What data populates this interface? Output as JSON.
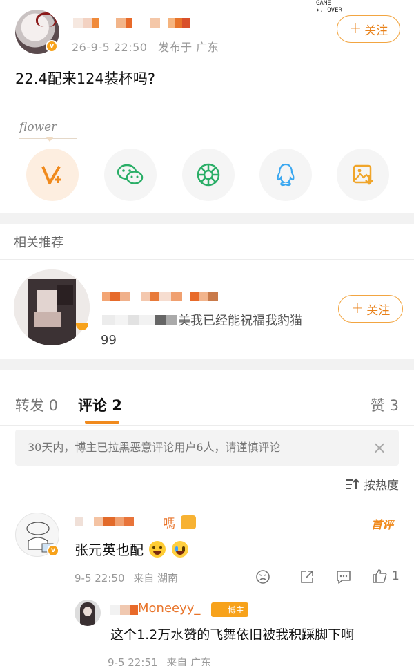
{
  "post": {
    "timestamp": "26-9-5 22:50",
    "location": "发布于 广东",
    "follow_label": "关注",
    "plus": "+",
    "text": "22.4配来124装杯吗?",
    "flower_label": "flower",
    "sticker_line1": "GAME",
    "sticker_line2": "✦. OVER"
  },
  "share": {
    "items": [
      "v-plus-icon",
      "wechat-icon",
      "moments-icon",
      "qq-icon",
      "save-image-icon"
    ]
  },
  "related": {
    "title": "相关推荐",
    "name_partial": "Moneeyy",
    "desc_partial": "美我已经能祝福我豹猫",
    "count": "99",
    "follow_label": "关注",
    "plus": "+"
  },
  "tabs": {
    "repost": "转发 0",
    "comments": "评论 2",
    "likes": "赞 3"
  },
  "notice": {
    "text": "30天内，博主已拉黑恶意评论用户6人，请谨慎评论",
    "close": "×"
  },
  "sort": {
    "label": "按热度"
  },
  "comments": [
    {
      "name_partial": "嗎",
      "badge": "首评",
      "text": "张元英也配",
      "timestamp": "9-5 22:50",
      "location": "来自 湖南",
      "likes": "1"
    },
    {
      "name_partial": "Moneeyy_",
      "author_badge": "博主",
      "text": "这个1.2万水赞的飞舞依旧被我积踩脚下啊",
      "timestamp": "9-5 22:51",
      "location": "来自 广东"
    }
  ],
  "colors": {
    "accent": "#f08a1d",
    "badge_orange": "#f7a21b",
    "muted": "#999999"
  }
}
